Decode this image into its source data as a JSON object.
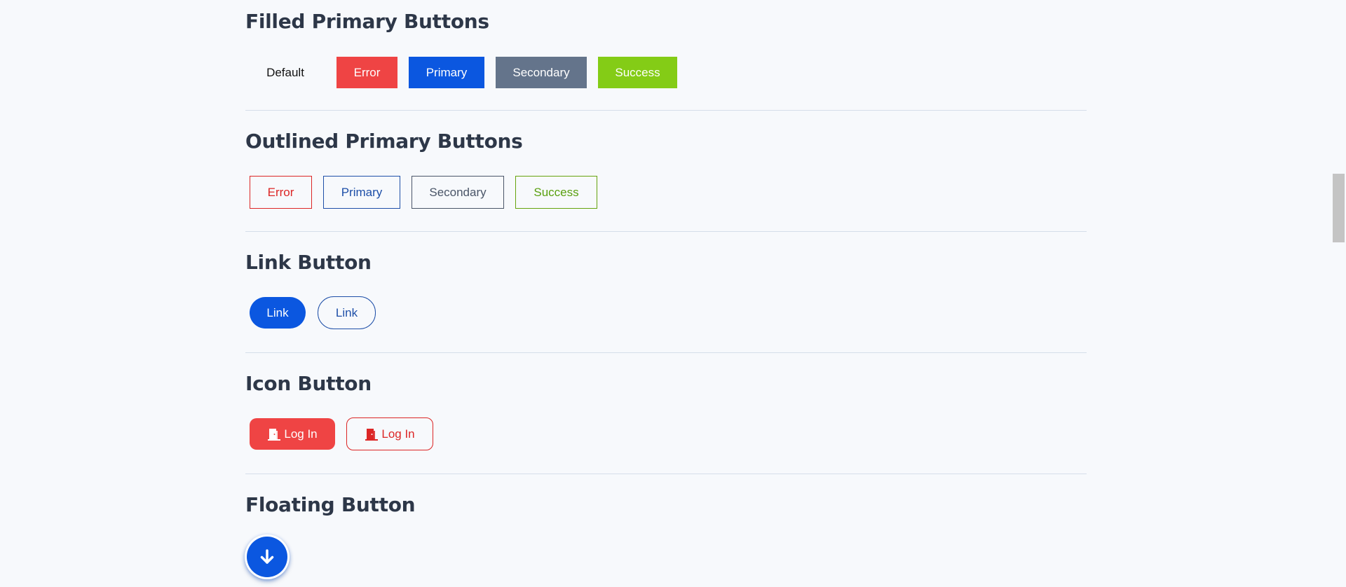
{
  "sections": {
    "filled": {
      "title": "Filled Primary Buttons",
      "buttons": {
        "default": "Default",
        "error": "Error",
        "primary": "Primary",
        "secondary": "Secondary",
        "success": "Success"
      }
    },
    "outlined": {
      "title": "Outlined Primary Buttons",
      "buttons": {
        "error": "Error",
        "primary": "Primary",
        "secondary": "Secondary",
        "success": "Success"
      }
    },
    "link": {
      "title": "Link Button",
      "buttons": {
        "filled": "Link",
        "outlined": "Link"
      }
    },
    "icon": {
      "title": "Icon Button",
      "buttons": {
        "filled": "Log In",
        "outlined": "Log In"
      },
      "icon_name": "door-icon"
    },
    "floating": {
      "title": "Floating Button",
      "icon_name": "arrow-down-icon"
    }
  },
  "colors": {
    "error": "#ef4444",
    "primary": "#0b57e0",
    "secondary": "#64748b",
    "success": "#84cc16",
    "heading": "#2d3748",
    "background": "#f7f9fc"
  }
}
